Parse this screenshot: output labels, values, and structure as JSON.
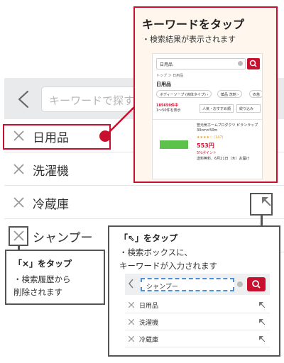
{
  "search": {
    "placeholder": "キーワードで探す"
  },
  "history": [
    {
      "label": "日用品"
    },
    {
      "label": "洗濯機"
    },
    {
      "label": "冷蔵庫"
    },
    {
      "label": "シャンプー"
    }
  ],
  "callout_keyword": {
    "title": "キーワードをタップ",
    "desc": "・検索結果が表示されます",
    "mini": {
      "query": "日用品",
      "breadcrumb": "トップ ＞ 日用品",
      "heading": "日用品",
      "chips": [
        "ボディーソープ (液体タイプ) ›",
        "薬品 洗剤 ›",
        "衣苗"
      ],
      "count_total": "185659件中",
      "count_range": "1〜50件を表示",
      "sort": "人気・おすすめ順",
      "filter": "絞り込み",
      "product_name": "笹元気ホームプロダクツ  ピランラップ 30cm×50m",
      "stars": "★★★★☆ (147)",
      "price": "553円",
      "points": "5%ポイント",
      "shipping": "送料無料、6月21日（木）お届け"
    }
  },
  "callout_x": {
    "title": "「×」をタップ",
    "desc_line1": "・検索履歴から",
    "desc_line2": "削除されます"
  },
  "callout_arrow": {
    "title": "「⇖」をタップ",
    "desc_line1": "・検索ボックスに、",
    "desc_line2": "キーワードが入力されます",
    "mini": {
      "query": "シャンプー",
      "rows": [
        {
          "label": "日用品"
        },
        {
          "label": "洗濯機"
        },
        {
          "label": "冷蔵庫"
        }
      ]
    }
  },
  "colors": {
    "accent": "#c8102e",
    "callout_border": "#555555",
    "callout1_bg": "#fff7ee",
    "dashed_input": "#4a8fd8"
  },
  "icons": {
    "back": "chevron-left-icon",
    "remove": "close-x-icon",
    "fill": "arrow-up-left-icon",
    "search": "search-icon",
    "clear": "clear-circle-icon"
  }
}
